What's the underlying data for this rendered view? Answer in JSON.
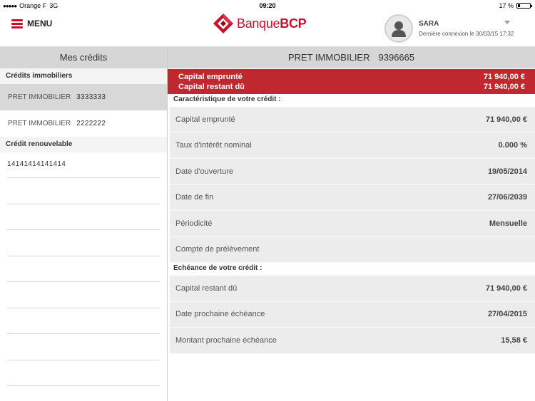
{
  "status_bar": {
    "carrier": "Orange F",
    "network": "3G",
    "time": "09:20",
    "battery": "17 %",
    "battery_level": 0.17
  },
  "header": {
    "menu_label": "MENU",
    "brand_name": "Banque",
    "brand_bold": "BCP",
    "user_name": "SARA",
    "last_login": "Dernière connexion le 30/03/15 17:32"
  },
  "sidebar": {
    "title": "Mes crédits",
    "section_mortgage": "Crédits immobiliers",
    "mortgage_items": [
      {
        "label": "PRET IMMOBILIER",
        "number": "3333333"
      },
      {
        "label": "PRET IMMOBILIER",
        "number": "2222222"
      }
    ],
    "section_revolving": "Crédit renouvelable",
    "revolving_items": [
      {
        "number": "14141414141414"
      }
    ]
  },
  "main": {
    "title_label": "PRET IMMOBILIER",
    "title_number": "9396665",
    "banner": {
      "borrowed_label": "Capital emprunté",
      "borrowed_value": "71 940,00 €",
      "remaining_label": "Capital restant dû",
      "remaining_value": "71 940,00 €"
    },
    "characteristics_title": "Caractéristique de votre crédit :",
    "characteristics": [
      {
        "label": "Capital emprunté",
        "value": "71 940,00 €"
      },
      {
        "label": "Taux d'intérêt nominal",
        "value": "0.000 %"
      },
      {
        "label": "Date d'ouverture",
        "value": "19/05/2014"
      },
      {
        "label": "Date de fin",
        "value": "27/06/2039"
      },
      {
        "label": "Périodicité",
        "value": "Mensuelle"
      },
      {
        "label": "Compte de prélèvement",
        "value": ""
      }
    ],
    "schedule_title": "Echéance de votre crédit :",
    "schedule": [
      {
        "label": "Capital restant dû",
        "value": "71 940,00 €"
      },
      {
        "label": "Date prochaine échéance",
        "value": "27/04/2015"
      },
      {
        "label": "Montant prochaine échéance",
        "value": "15,58 €"
      }
    ]
  }
}
